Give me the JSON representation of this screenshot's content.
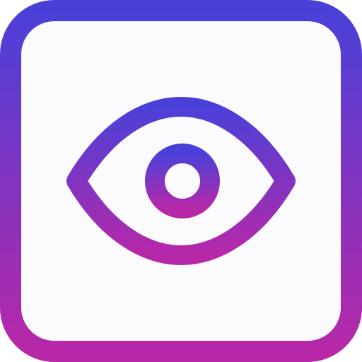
{
  "icon": {
    "name": "eye-icon",
    "frame": "rounded-square",
    "gradient": {
      "top": "#4a40d8",
      "bottom": "#b728a8"
    },
    "fill": "#fbfafd"
  }
}
